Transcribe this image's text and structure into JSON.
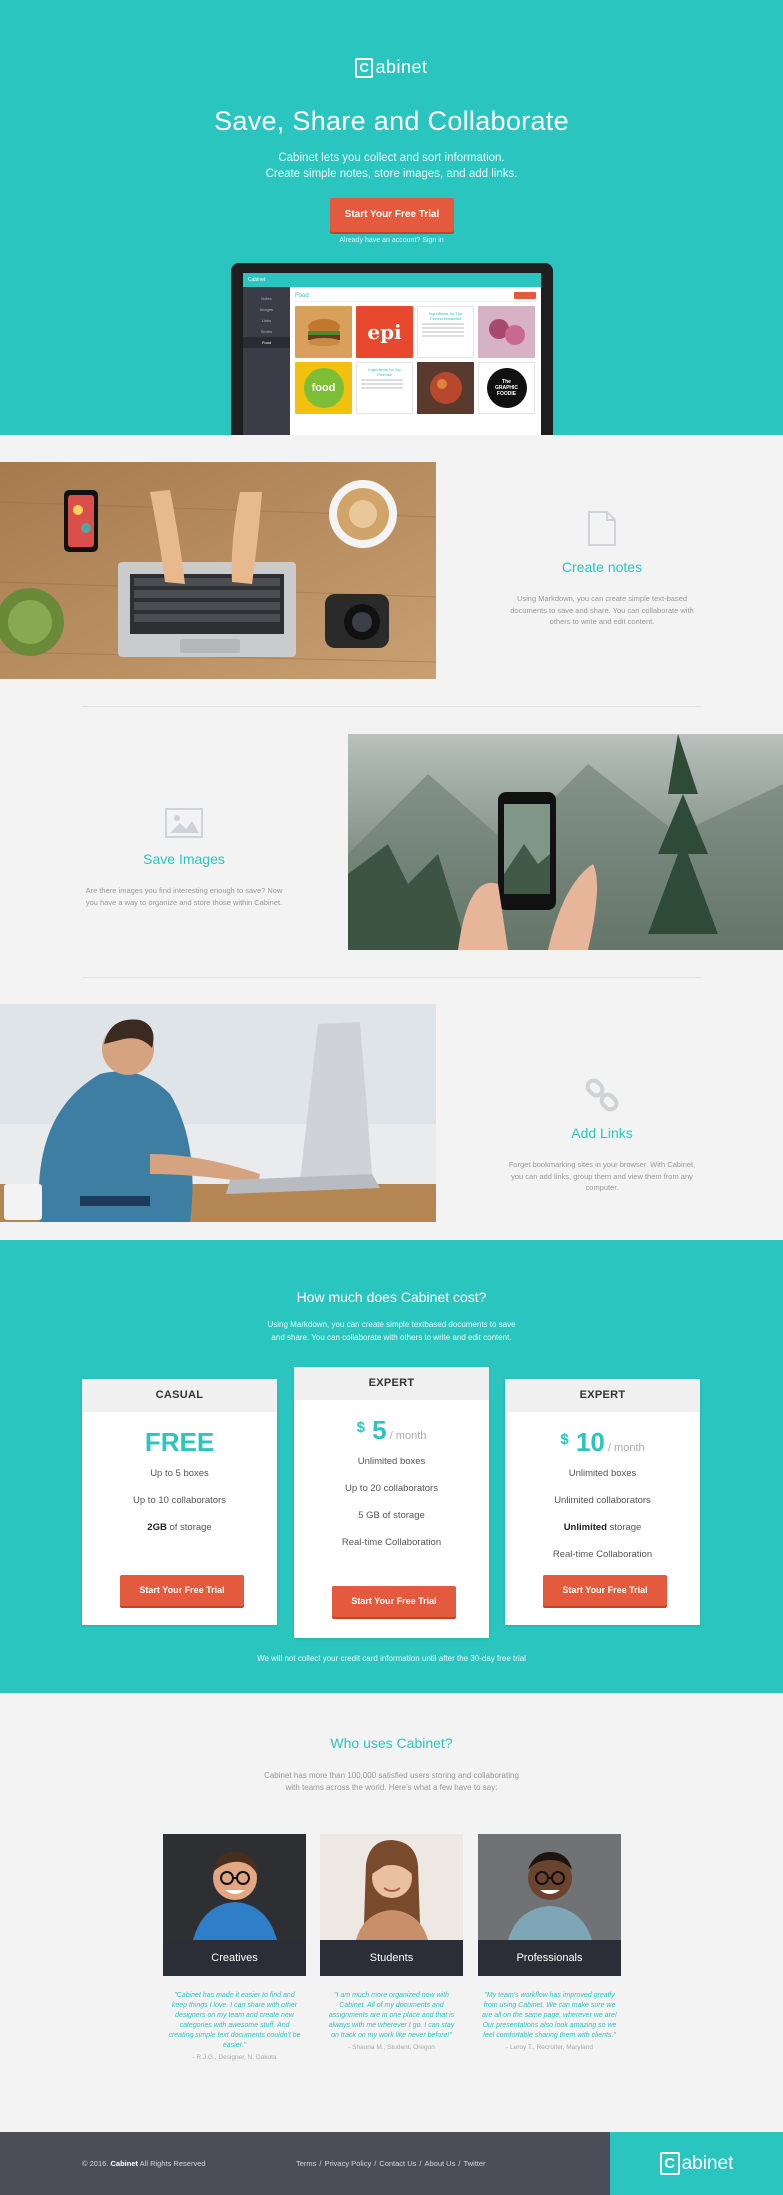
{
  "brand": {
    "logo_letter": "C",
    "logo_rest": "abinet"
  },
  "hero": {
    "title": "Save, Share and Collaborate",
    "subtitle_line1": "Cabinet lets you collect and sort information.",
    "subtitle_line2": "Create simple notes, store images, and add links.",
    "cta": "Start Your Free Trial",
    "signin": "Already have an account? Sign in"
  },
  "app_preview": {
    "app_name": "Cabinet",
    "section": "Food",
    "sidebar": [
      "Notes",
      "Images",
      "Links",
      "Stores",
      "Food"
    ],
    "cards": [
      "",
      "epi",
      "Ingredients for The Perfect Breakfast",
      "",
      "food",
      "Ingredients for Sip Promise",
      "",
      "The GRAPHIC FOODIE"
    ]
  },
  "features": [
    {
      "title": "Create notes",
      "icon": "document-icon",
      "text": "Using Markdown, you can create simple text-based documents to save and share. You can collaborate with others to write and edit content."
    },
    {
      "title": "Save Images",
      "icon": "image-icon",
      "text": "Are there images you find interesting enough to save? Now you have a way to organize and store those within Cabinet."
    },
    {
      "title": "Add Links",
      "icon": "link-icon",
      "text": "Forget bookmarking sites in your browser. With Cabinet, you can add links, group them and view them from any computer."
    }
  ],
  "pricing": {
    "title": "How much does Cabinet cost?",
    "lead_line1": "Using Markdown, you can create simple textbased documents to save",
    "lead_line2": "and share. You can collaborate with others to write and edit content.",
    "plans": [
      {
        "name": "CASUAL",
        "price": "FREE",
        "currency": "",
        "period": "",
        "features": [
          "Up to 5 boxes",
          "Up to 10 collaborators"
        ],
        "storage_bold": "2GB",
        "storage_rest": " of storage",
        "cta": "Start Your Free Trial"
      },
      {
        "name": "EXPERT",
        "price": "5",
        "currency": "$",
        "period": " / month",
        "features": [
          "Unlimited boxes",
          "Up to 20 collaborators",
          "5 GB of storage",
          "Real-time Collaboration"
        ],
        "cta": "Start Your Free Trial"
      },
      {
        "name": "EXPERT",
        "price": "10",
        "currency": "$",
        "period": " / month",
        "features": [
          "Unlimited boxes",
          "Unlimited collaborators"
        ],
        "storage_bold": "Unlimited",
        "storage_rest": " storage",
        "extra": "Real-time Collaboration",
        "cta": "Start Your Free Trial"
      }
    ],
    "note": "We will not collect your credit card information until after the 30-day free trial"
  },
  "users": {
    "title": "Who uses Cabinet?",
    "lead_line1": "Cabinet has more than 100,000 satisfied users storing and collaborating",
    "lead_line2": "with teams across the world. Here's what a few have to say:",
    "personas": [
      {
        "label": "Creatives",
        "quote": "\"Cabinet has made it easier to find and keep things I love. I can share with other designers on my team and create new categories with awesome stuff. And creating simple text documents couldn't be easier.\"",
        "author": "- R.J.G., Designer, N. Dakota"
      },
      {
        "label": "Students",
        "quote": "\"I am much more organized now with Cabinet. All of my documents and assignments are in one place and that is always with me wherever I go. I can stay on track on my work like never before!\"",
        "author": "- Shauna M., Student, Oregon"
      },
      {
        "label": "Professionals",
        "quote": "\"My team's workflow has improved greatly from using Cabinet. We can make sure we are all on the same page, wherever we are! Our presentations also look amazing so we feel comfortable sharing them with clients.\"",
        "author": "- Leroy T., Recruiter, Maryland"
      }
    ]
  },
  "footer": {
    "copyright_prefix": "© 2016.",
    "copyright_brand": "Cabinet",
    "copyright_suffix": "All Rights Reserved",
    "links": [
      "Terms",
      "Privacy Policy",
      "Contact Us",
      "About Us",
      "Twitter"
    ],
    "separator": "/"
  },
  "colors": {
    "teal": "#2bc5c0",
    "orange": "#e45a3f",
    "dark": "#4b4d58"
  }
}
